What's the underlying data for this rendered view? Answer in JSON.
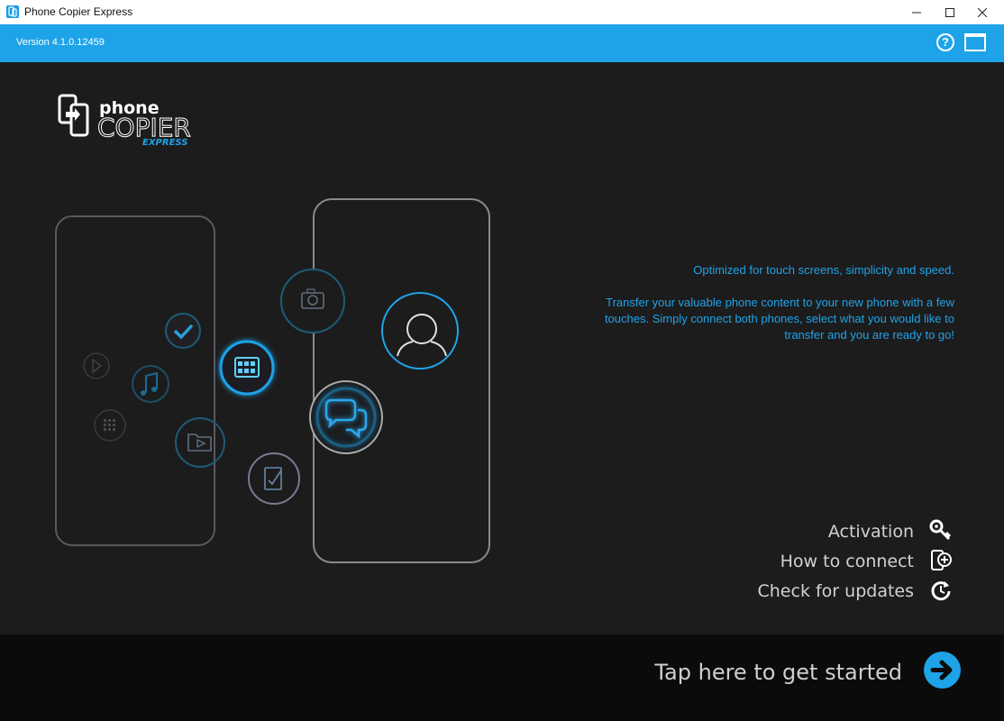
{
  "window": {
    "title": "Phone Copier Express",
    "controls": [
      "minimize",
      "maximize",
      "close"
    ]
  },
  "header": {
    "version": "Version 4.1.0.12459",
    "help_label": "?",
    "help_icon": "help-icon",
    "window_mode_icon": "window-icon"
  },
  "logo": {
    "line1": "phone",
    "line2": "COPIER",
    "line3": "EXPRESS"
  },
  "description": {
    "line1": "Optimized for touch screens, simplicity and speed.",
    "line2": "Transfer your valuable phone content to your new phone with a few touches. Simply connect both phones, select what you would like to transfer and you are ready to go!"
  },
  "links": [
    {
      "label": "Activation",
      "icon": "key-icon"
    },
    {
      "label": "How to connect",
      "icon": "connect-phone-icon"
    },
    {
      "label": "Check for updates",
      "icon": "update-icon"
    }
  ],
  "footer": {
    "start_label": "Tap here to get started",
    "start_icon": "arrow-right-icon"
  },
  "colors": {
    "accent": "#1fa3e8",
    "background": "#1c1c1d",
    "footer": "#0b0b0b"
  }
}
